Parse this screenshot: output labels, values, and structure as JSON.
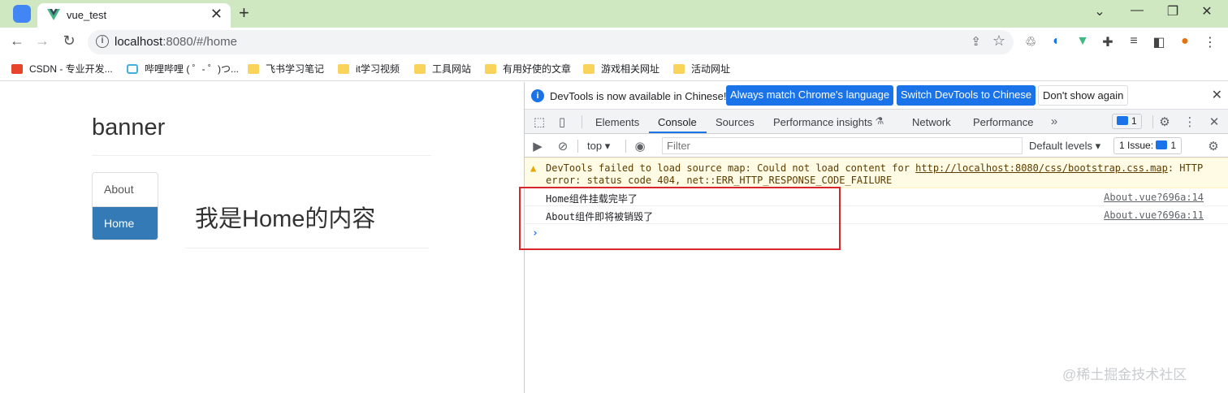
{
  "browser": {
    "tab": {
      "title": "vue_test",
      "close": "✕"
    },
    "new_tab": "+",
    "url": {
      "host": "localhost",
      "rest": ":8080/#/home"
    },
    "bookmarks": [
      {
        "label": "CSDN - 专业开发..."
      },
      {
        "label": "哔哩哔哩 ( ゜- ゜)つ..."
      },
      {
        "label": "飞书学习笔记"
      },
      {
        "label": "it学习视频"
      },
      {
        "label": "工具网站"
      },
      {
        "label": "有用好使的文章"
      },
      {
        "label": "游戏相关网址"
      },
      {
        "label": "活动网址"
      }
    ]
  },
  "page": {
    "banner": "banner",
    "nav": [
      {
        "label": "About",
        "active": false
      },
      {
        "label": "Home",
        "active": true
      }
    ],
    "home_content": "我是Home的内容"
  },
  "devtools": {
    "infobar": {
      "message": "DevTools is now available in Chinese!",
      "btn_match": "Always match Chrome's language",
      "btn_switch": "Switch DevTools to Chinese",
      "btn_dismiss": "Don't show again"
    },
    "tabs": [
      "Elements",
      "Console",
      "Sources",
      "Performance insights",
      "Network",
      "Performance"
    ],
    "active_tab": "Console",
    "message_count": "1",
    "filter": {
      "context": "top",
      "placeholder": "Filter",
      "levels": "Default levels",
      "issues": "1 Issue:",
      "issues_count": "1"
    },
    "console": {
      "warning": {
        "text_before": "DevTools failed to load source map: Could not load content for ",
        "link": "http://localhost:8080/css/bootstrap.css.map",
        "text_after": ": HTTP",
        "line2": "error: status code 404, net::ERR_HTTP_RESPONSE_CODE_FAILURE"
      },
      "logs": [
        {
          "text": "Home组件挂载完毕了",
          "source": "About.vue?696a:14"
        },
        {
          "text": "About组件即将被销毁了",
          "source": "About.vue?696a:11"
        }
      ],
      "prompt": "›"
    }
  },
  "watermark": "@稀土掘金技术社区",
  "colors": {
    "accent": "#1a73e8",
    "nav_active": "#337ab7",
    "highlight": "#d9262c",
    "tabstrip": "#cfe8c1"
  }
}
